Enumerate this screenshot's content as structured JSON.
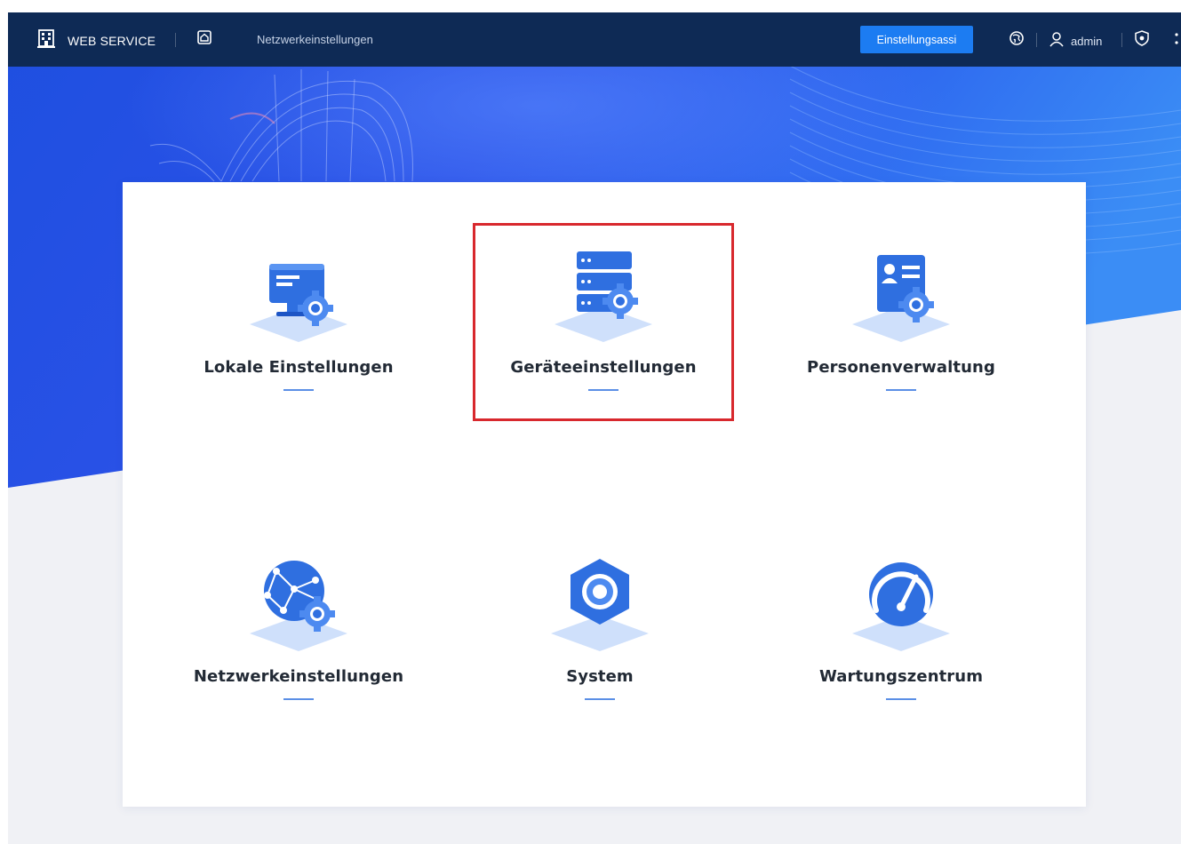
{
  "header": {
    "brand": "WEB SERVICE",
    "breadcrumb": "Netzwerkeinstellungen",
    "assist_button": "Einstellungsassi",
    "user": "admin"
  },
  "tiles": [
    {
      "label": "Lokale Einstellungen",
      "icon": "monitor-gear-icon"
    },
    {
      "label": "Geräteeinstellungen",
      "icon": "server-gear-icon",
      "selected": true
    },
    {
      "label": "Personenverwaltung",
      "icon": "id-card-gear-icon"
    },
    {
      "label": "Netzwerkeinstellungen",
      "icon": "globe-gear-icon"
    },
    {
      "label": "System",
      "icon": "hexagon-gear-icon"
    },
    {
      "label": "Wartungszentrum",
      "icon": "speedometer-icon"
    }
  ],
  "colors": {
    "topbar": "#0e2a55",
    "accent": "#1c7cf2",
    "icon_blue": "#2f6fe0",
    "highlight_border": "#d8282d"
  }
}
